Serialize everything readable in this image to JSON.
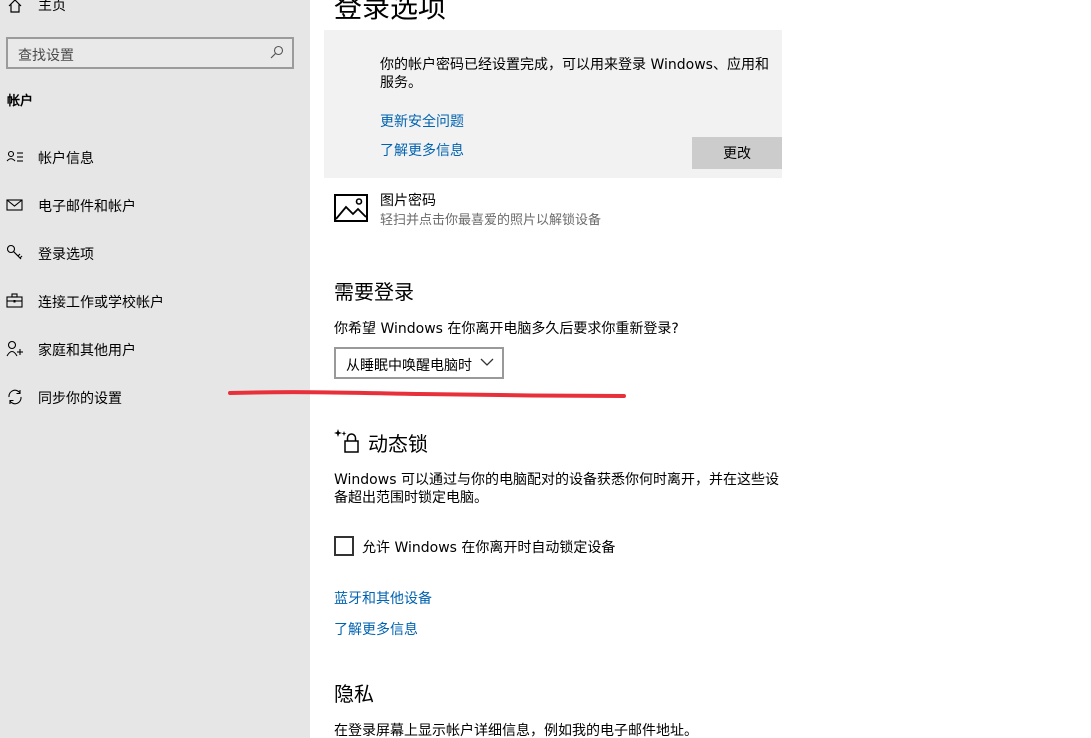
{
  "sidebar": {
    "home_label": "主页",
    "search_placeholder": "查找设置",
    "section_label": "帐户",
    "items": [
      {
        "label": "帐户信息",
        "icon": "account-info-icon"
      },
      {
        "label": "电子邮件和帐户",
        "icon": "mail-icon"
      },
      {
        "label": "登录选项",
        "icon": "key-icon"
      },
      {
        "label": "连接工作或学校帐户",
        "icon": "briefcase-icon"
      },
      {
        "label": "家庭和其他用户",
        "icon": "add-user-icon"
      },
      {
        "label": "同步你的设置",
        "icon": "sync-icon"
      }
    ]
  },
  "main": {
    "title": "登录选项",
    "security_panel": {
      "description": "你的帐户密码已经设置完成，可以用来登录 Windows、应用和服务。",
      "link_update_security": "更新安全问题",
      "link_learn_more": "了解更多信息",
      "change_button": "更改"
    },
    "picture_password": {
      "title": "图片密码",
      "description": "轻扫并点击你最喜爱的照片以解锁设备"
    },
    "require_signin": {
      "heading": "需要登录",
      "question": "你希望 Windows 在你离开电脑多久后要求你重新登录?",
      "dropdown_value": "从睡眠中唤醒电脑时"
    },
    "dynamic_lock": {
      "heading": "动态锁",
      "description": "Windows 可以通过与你的电脑配对的设备获悉你何时离开，并在这些设备超出范围时锁定电脑。",
      "checkbox_label": "允许 Windows 在你离开时自动锁定设备",
      "checkbox_checked": false,
      "link_bluetooth": "蓝牙和其他设备",
      "link_learn_more": "了解更多信息"
    },
    "privacy": {
      "heading": "隐私",
      "description": "在登录屏幕上显示帐户详细信息，例如我的电子邮件地址。"
    }
  },
  "colors": {
    "sidebar_bg": "#e6e6e6",
    "link": "#0063b1",
    "annotation": "#e8303a"
  }
}
